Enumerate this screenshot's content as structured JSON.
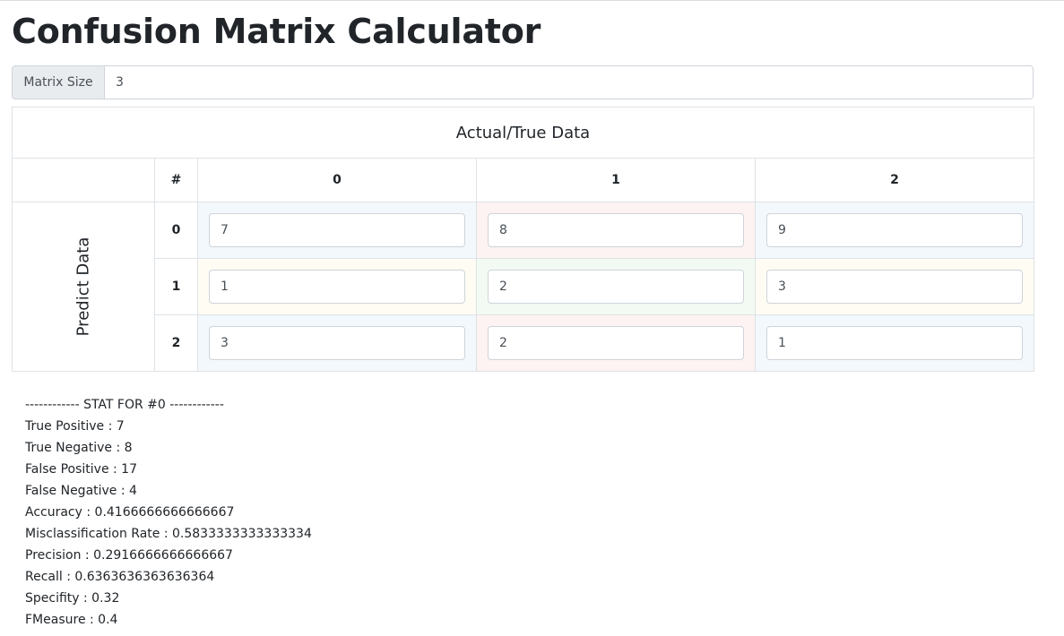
{
  "title": "Confusion Matrix Calculator",
  "matrix_size": {
    "label": "Matrix Size",
    "value": "3"
  },
  "table": {
    "actual_header": "Actual/True Data",
    "predict_header": "Predict Data",
    "hash": "#",
    "columns": [
      "0",
      "1",
      "2"
    ],
    "rows": [
      {
        "label": "0",
        "cells": [
          "7",
          "8",
          "9"
        ]
      },
      {
        "label": "1",
        "cells": [
          "1",
          "2",
          "3"
        ]
      },
      {
        "label": "2",
        "cells": [
          "3",
          "2",
          "1"
        ]
      }
    ]
  },
  "stats": {
    "header": "------------ STAT FOR #0 ------------",
    "lines": [
      "True Positive : 7",
      "True Negative : 8",
      "False Positive : 17",
      "False Negative : 4",
      "Accuracy : 0.4166666666666667",
      "Misclassification Rate : 0.5833333333333334",
      "Precision : 0.2916666666666667",
      "Recall : 0.6363636363636364",
      "Specifity : 0.32",
      "FMeasure : 0.4"
    ]
  },
  "colors": {
    "tint_blue": "#f3f8fc",
    "tint_red": "#fdf3f2",
    "tint_yellow": "#fefcf3",
    "tint_green": "#f3faf4"
  }
}
